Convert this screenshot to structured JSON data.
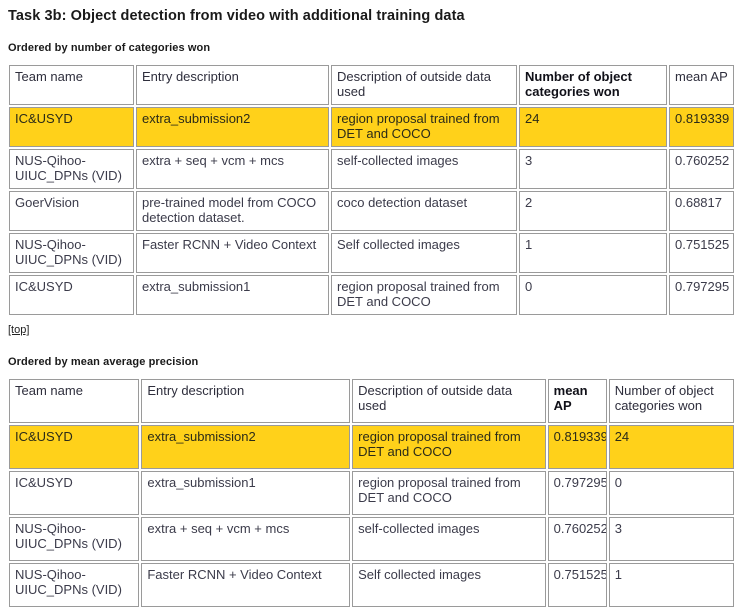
{
  "page": {
    "title": "Task 3b: Object detection from video with additional training data",
    "top_link_label": "[top]",
    "highlight_color": "#FFD11A"
  },
  "sections": [
    {
      "label": "Ordered by number of categories won",
      "sort_key_column": "Number of object categories won",
      "columns": [
        "Team name",
        "Entry description",
        "Description of outside data used",
        "Number of object categories won",
        "mean AP"
      ],
      "rows": [
        {
          "team": "IC&USYD",
          "entry": "extra_submission2",
          "outside_data": "region proposal trained from DET and COCO",
          "categories_won": "24",
          "mean_ap": "0.819339",
          "highlight": true
        },
        {
          "team": "NUS-Qihoo-UIUC_DPNs (VID)",
          "entry": "extra + seq + vcm + mcs",
          "outside_data": "self-collected images",
          "categories_won": "3",
          "mean_ap": "0.760252",
          "highlight": false
        },
        {
          "team": "GoerVision",
          "entry": "pre-trained model from COCO detection dataset.",
          "outside_data": "coco detection dataset",
          "categories_won": "2",
          "mean_ap": "0.68817",
          "highlight": false
        },
        {
          "team": "NUS-Qihoo-UIUC_DPNs (VID)",
          "entry": "Faster RCNN + Video Context",
          "outside_data": "Self collected images",
          "categories_won": "1",
          "mean_ap": "0.751525",
          "highlight": false
        },
        {
          "team": "IC&USYD",
          "entry": "extra_submission1",
          "outside_data": "region proposal trained from DET and COCO",
          "categories_won": "0",
          "mean_ap": "0.797295",
          "highlight": false
        }
      ]
    },
    {
      "label": "Ordered by mean average precision",
      "sort_key_column": "mean AP",
      "columns": [
        "Team name",
        "Entry description",
        "Description of outside data used",
        "mean AP",
        "Number of object categories won"
      ],
      "rows": [
        {
          "team": "IC&USYD",
          "entry": "extra_submission2",
          "outside_data": "region proposal trained from DET and COCO",
          "mean_ap": "0.819339",
          "categories_won": "24",
          "highlight": true
        },
        {
          "team": "IC&USYD",
          "entry": "extra_submission1",
          "outside_data": "region proposal trained from DET and COCO",
          "mean_ap": "0.797295",
          "categories_won": "0",
          "highlight": false
        },
        {
          "team": "NUS-Qihoo-UIUC_DPNs (VID)",
          "entry": "extra + seq + vcm + mcs",
          "outside_data": "self-collected images",
          "mean_ap": "0.760252",
          "categories_won": "3",
          "highlight": false
        },
        {
          "team": "NUS-Qihoo-UIUC_DPNs (VID)",
          "entry": "Faster RCNN + Video Context",
          "outside_data": "Self collected images",
          "mean_ap": "0.751525",
          "categories_won": "1",
          "highlight": false
        }
      ]
    }
  ]
}
